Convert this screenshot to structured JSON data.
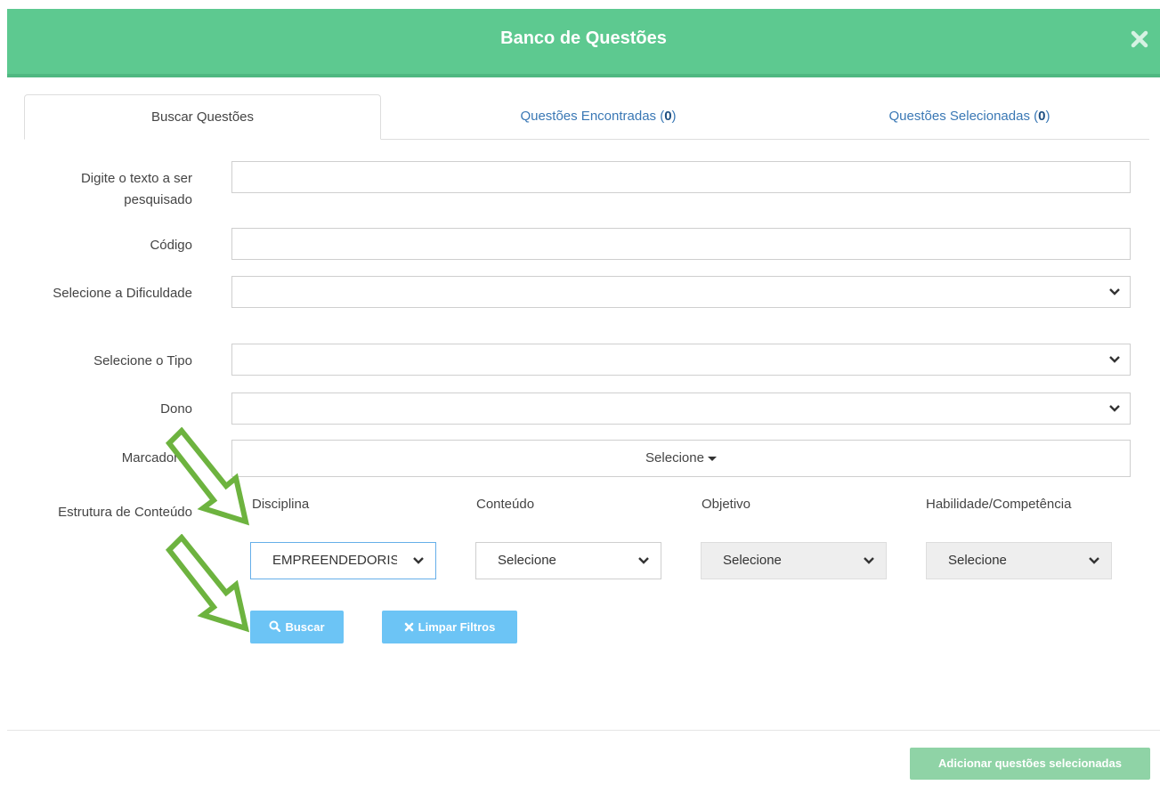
{
  "modal": {
    "title": "Banco de Questões",
    "close_icon": "close-icon"
  },
  "tabs": {
    "search": "Buscar Questões",
    "found_label": "Questões Encontradas (",
    "found_count": "0",
    "selected_label": "Questões Selecionadas (",
    "selected_count": "0",
    "close_paren": ")"
  },
  "form": {
    "text_search_label": "Digite o texto a ser pesquisado",
    "text_search_value": "",
    "code_label": "Código",
    "code_value": "",
    "difficulty_label": "Selecione a Dificuldade",
    "difficulty_value": "",
    "type_label": "Selecione o Tipo",
    "type_value": "",
    "owner_label": "Dono",
    "owner_value": "",
    "markers_label": "Marcadores",
    "markers_value": "Selecione",
    "structure_label": "Estrutura de Conteúdo"
  },
  "structure": {
    "discipline_label": "Disciplina",
    "discipline_value": "EMPREENDEDORISMO",
    "content_label": "Conteúdo",
    "content_value": "Selecione",
    "objective_label": "Objetivo",
    "objective_value": "Selecione",
    "skill_label": "Habilidade/Competência",
    "skill_value": "Selecione"
  },
  "buttons": {
    "search": "Buscar",
    "clear": "Limpar Filtros",
    "add_selected": "Adicionar questões selecionadas"
  },
  "annotations": {
    "arrow_color": "#6db33f",
    "arrow_1": "pointing to Disciplina select",
    "arrow_2": "pointing to Buscar button"
  },
  "colors": {
    "header_bg": "#5dc990",
    "primary_btn": "#6cc4f5",
    "add_btn": "#8fd3a6",
    "link": "#3a78b5"
  }
}
